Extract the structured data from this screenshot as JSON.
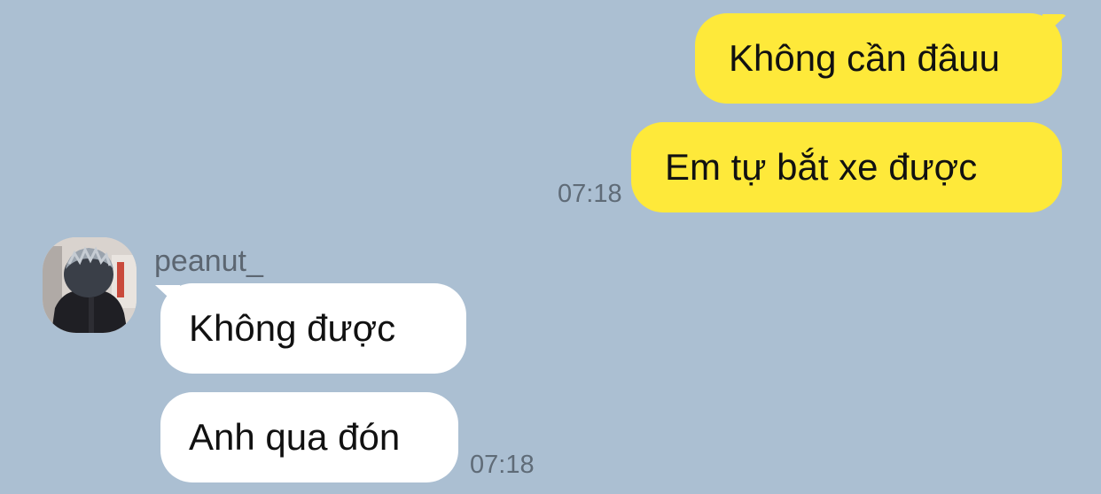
{
  "chat": {
    "outgoing": {
      "messages": [
        "Không cần đâuu",
        "Em tự bắt xe được"
      ],
      "time": "07:18"
    },
    "incoming": {
      "sender": "peanut_",
      "messages": [
        "Không được",
        "Anh qua đón"
      ],
      "time": "07:18"
    }
  },
  "colors": {
    "background": "#abbfd2",
    "outgoing_bubble": "#fee93a",
    "incoming_bubble": "#ffffff",
    "timestamp": "#5f6b77"
  }
}
